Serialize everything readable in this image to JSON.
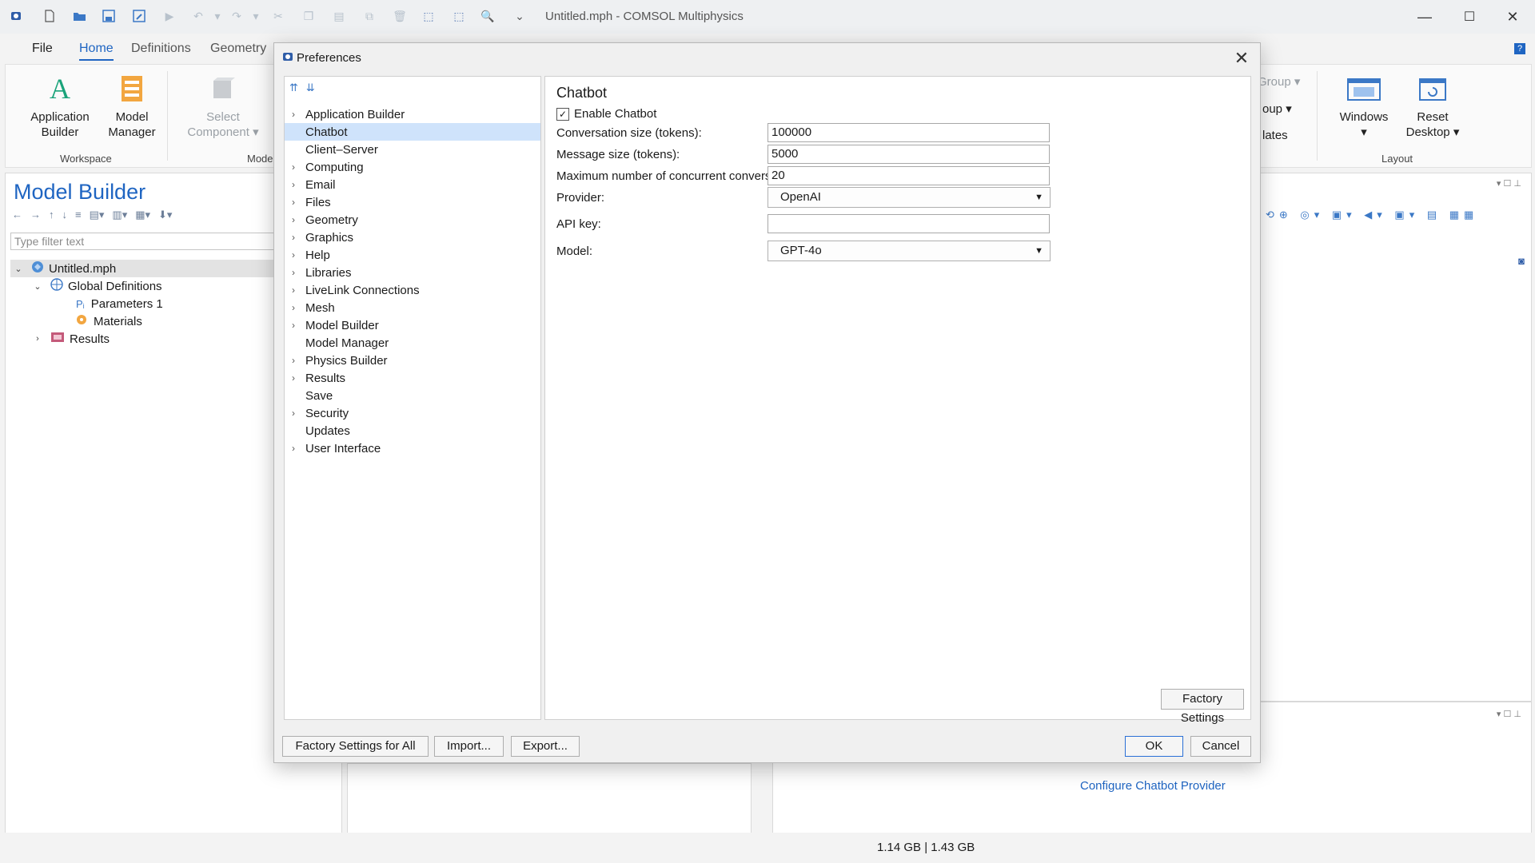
{
  "window": {
    "title": "Untitled.mph - COMSOL Multiphysics"
  },
  "ribbon": {
    "tabs": [
      "File",
      "Home",
      "Definitions",
      "Geometry"
    ],
    "workspace": {
      "app_builder": [
        "Application",
        "Builder"
      ],
      "model_manager": [
        "Model",
        "Manager"
      ],
      "group_label": "Workspace"
    },
    "model_group": {
      "select_component": [
        "Select",
        "Component"
      ],
      "group_label": "Mode"
    },
    "partial": {
      "group1": "Group",
      "group2": "oup",
      "plates": "lates"
    },
    "layout": {
      "windows": "Windows",
      "reset_desktop": [
        "Reset",
        "Desktop"
      ],
      "group_label": "Layout"
    }
  },
  "model_builder": {
    "title": "Model Builder",
    "filter_placeholder": "Type filter text",
    "tree": {
      "root": "Untitled.mph",
      "global_definitions": "Global Definitions",
      "parameters": "Parameters 1",
      "materials": "Materials",
      "results": "Results"
    }
  },
  "dialog": {
    "title": "Preferences",
    "nav_items": [
      {
        "label": "Application Builder",
        "expandable": true
      },
      {
        "label": "Chatbot",
        "expandable": false,
        "selected": true
      },
      {
        "label": "Client–Server",
        "expandable": false
      },
      {
        "label": "Computing",
        "expandable": true
      },
      {
        "label": "Email",
        "expandable": true
      },
      {
        "label": "Files",
        "expandable": true
      },
      {
        "label": "Geometry",
        "expandable": true
      },
      {
        "label": "Graphics",
        "expandable": true
      },
      {
        "label": "Help",
        "expandable": true
      },
      {
        "label": "Libraries",
        "expandable": true
      },
      {
        "label": "LiveLink Connections",
        "expandable": true
      },
      {
        "label": "Mesh",
        "expandable": true
      },
      {
        "label": "Model Builder",
        "expandable": true
      },
      {
        "label": "Model Manager",
        "expandable": false
      },
      {
        "label": "Physics Builder",
        "expandable": true
      },
      {
        "label": "Results",
        "expandable": true
      },
      {
        "label": "Save",
        "expandable": false
      },
      {
        "label": "Security",
        "expandable": true
      },
      {
        "label": "Updates",
        "expandable": false
      },
      {
        "label": "User Interface",
        "expandable": true
      }
    ],
    "section_title": "Chatbot",
    "enable_chatbot": {
      "label": "Enable Chatbot",
      "checked": true
    },
    "fields": {
      "conversation_size": {
        "label": "Conversation size (tokens):",
        "value": "100000"
      },
      "message_size": {
        "label": "Message size (tokens):",
        "value": "5000"
      },
      "max_concurrent": {
        "label": "Maximum number of concurrent conversations:",
        "value": "20"
      },
      "provider": {
        "label": "Provider:",
        "value": "OpenAI"
      },
      "api_key": {
        "label": "API key:",
        "value": ""
      },
      "model": {
        "label": "Model:",
        "value": "GPT-4o"
      }
    },
    "buttons": {
      "factory_settings": "Factory Settings",
      "factory_settings_all": "Factory Settings for All",
      "import": "Import...",
      "export": "Export...",
      "ok": "OK",
      "cancel": "Cancel"
    }
  },
  "background": {
    "configure_link": "Configure Chatbot Provider"
  },
  "status": {
    "memory": "1.14 GB | 1.43 GB"
  },
  "colors": {
    "accent": "#1f65c2",
    "selection": "#cfe3fb"
  }
}
